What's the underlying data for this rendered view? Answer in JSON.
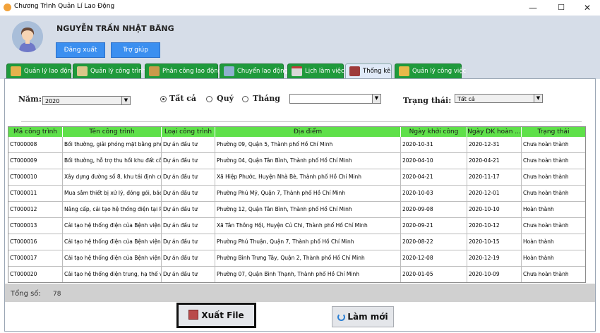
{
  "window": {
    "title": "Chương Trình Quản Lí Lao Động",
    "minimize": "—",
    "maximize": "☐",
    "close": "✕"
  },
  "header": {
    "user_name": "NGUYỄN TRẦN NHẬT BĂNG",
    "logout_label": "Đăng xuất",
    "help_label": "Trợ giúp"
  },
  "tabs": [
    {
      "label": "Quản lý lao động",
      "icon": "worker-icon"
    },
    {
      "label": "Quản lý công trình",
      "icon": "building-icon"
    },
    {
      "label": "Phân công lao động",
      "icon": "assignment-icon"
    },
    {
      "label": "Chuyển lao động",
      "icon": "transfer-icon"
    },
    {
      "label": "Lịch làm việc",
      "icon": "calendar-icon"
    },
    {
      "label": "Thống kê",
      "icon": "statistics-icon"
    },
    {
      "label": "Quản lý công việc",
      "icon": "folder-icon"
    }
  ],
  "filters": {
    "year_label": "Năm:",
    "year_value": "2020",
    "radio_all": "Tất cả",
    "radio_quarter": "Quý",
    "radio_month": "Tháng",
    "month_value": "",
    "status_label": "Trạng thái:",
    "status_value": "Tất cả"
  },
  "table": {
    "columns": [
      "Mã công trình",
      "Tên công trình",
      "Loại công trình",
      "Địa điểm",
      "Ngày khởi công",
      "Ngày DK hoàn ...",
      "Trạng thái"
    ],
    "rows": [
      [
        "CT000008",
        "Bồi thường, giải phóng mặt bằng phu...",
        "Dự án đầu tư",
        "Phường 09, Quận 5, Thành phố Hồ Chí Minh",
        "2020-10-31",
        "2020-12-31",
        "Chưa hoàn thành"
      ],
      [
        "CT000009",
        "Bồi thường, hỗ trợ thu hồi khu đất côn...",
        "Dự án đầu tư",
        "Phường 04, Quận Tân Bình, Thành phố Hồ Chí Minh",
        "2020-04-10",
        "2020-04-21",
        "Chưa hoàn thành"
      ],
      [
        "CT000010",
        "Xây dựng đường số 8, khu tái định cư ...",
        "Dự án đầu tư",
        "Xã Hiệp Phước, Huyện Nhà Bè, Thành phố Hồ Chí Minh",
        "2020-04-21",
        "2020-11-17",
        "Chưa hoàn thành"
      ],
      [
        "CT000011",
        "Mua sắm thiết bị xử lý, đóng gói, bảo ...",
        "Dự án đầu tư",
        "Phường Phú Mỹ, Quận 7, Thành phố Hồ Chí Minh",
        "2020-10-03",
        "2020-12-01",
        "Chưa hoàn thành"
      ],
      [
        "CT000012",
        "Nâng cấp, cải tạo hệ thống điện tại Ph...",
        "Dự án đầu tư",
        "Phường 12, Quận Tân Bình, Thành phố Hồ Chí Minh",
        "2020-09-08",
        "2020-10-10",
        "Hoàn thành"
      ],
      [
        "CT000013",
        "Cải tạo hệ thống điện của Bệnh viện q...",
        "Dự án đầu tư",
        "Xã Tân Thông Hội, Huyện Củ Chi, Thành phố Hồ Chí Minh",
        "2020-09-21",
        "2020-10-12",
        "Chưa hoàn thành"
      ],
      [
        "CT000016",
        "Cải tạo hệ thống điện của Bệnh viện ...",
        "Dự án đầu tư",
        "Phường Phú Thuận, Quận 7, Thành phố Hồ Chí Minh",
        "2020-08-22",
        "2020-10-15",
        "Hoàn thành"
      ],
      [
        "CT000017",
        "Cải tạo hệ thống điện của Bệnh viện b...",
        "Dự án đầu tư",
        "Phường Bình Trưng Tây, Quận 2, Thành phố Hồ Chí Minh",
        "2020-12-08",
        "2020-12-19",
        "Hoàn thành"
      ],
      [
        "CT000020",
        "Cải tạo hệ thống điện trung, hạ thế và ...",
        "Dự án đầu tư",
        "Phường 07, Quận Bình Thạnh, Thành phố Hồ Chí Minh",
        "2020-01-05",
        "2020-10-09",
        "Chưa hoàn thành"
      ]
    ]
  },
  "footer": {
    "total_label": "Tổng số:",
    "total_value": "78",
    "export_label": "Xuất File",
    "refresh_label": "Làm mới"
  },
  "colors": {
    "header_bg": "#d6dde8",
    "tab_green": "#1f9a3c",
    "table_header": "#5fe04a",
    "button_blue": "#3b8ff0"
  }
}
